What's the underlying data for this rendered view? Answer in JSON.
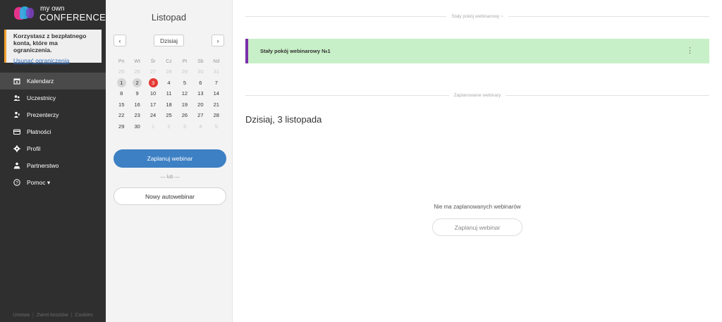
{
  "brand": {
    "line1": "my own",
    "line2": "CONFERENCE"
  },
  "notice": {
    "text": "Korzystasz z bezpłatnego konta, które ma ograniczenia.",
    "link": "Usunąć ograniczenia"
  },
  "nav": [
    {
      "label": "Kalendarz",
      "icon": "calendar-icon",
      "active": true
    },
    {
      "label": "Uczestnicy",
      "icon": "users-icon",
      "active": false
    },
    {
      "label": "Prezenterzy",
      "icon": "presenter-icon",
      "active": false
    },
    {
      "label": "Płatności",
      "icon": "card-icon",
      "active": false
    },
    {
      "label": "Profil",
      "icon": "gear-icon",
      "active": false
    },
    {
      "label": "Partnerstwo",
      "icon": "partnership-icon",
      "active": false
    },
    {
      "label": "Pomoc ▾",
      "icon": "help-icon",
      "active": false
    }
  ],
  "footer": [
    "Umowa",
    "Zwrot kosztów",
    "Cookies"
  ],
  "calendar": {
    "month": "Listopad",
    "prev": "‹",
    "next": "›",
    "today_label": "Dzisiaj",
    "weekdays": [
      "Pn",
      "Wt",
      "Śr",
      "Cz",
      "Pt",
      "Sb",
      "Nd"
    ],
    "weeks": [
      [
        {
          "d": "25",
          "s": "muted"
        },
        {
          "d": "26",
          "s": "muted"
        },
        {
          "d": "27",
          "s": "muted"
        },
        {
          "d": "28",
          "s": "muted"
        },
        {
          "d": "29",
          "s": "muted"
        },
        {
          "d": "30",
          "s": "muted"
        },
        {
          "d": "31",
          "s": "muted"
        }
      ],
      [
        {
          "d": "1",
          "s": "past"
        },
        {
          "d": "2",
          "s": "past"
        },
        {
          "d": "3",
          "s": "today"
        },
        {
          "d": "4",
          "s": ""
        },
        {
          "d": "5",
          "s": ""
        },
        {
          "d": "6",
          "s": ""
        },
        {
          "d": "7",
          "s": ""
        }
      ],
      [
        {
          "d": "8",
          "s": ""
        },
        {
          "d": "9",
          "s": ""
        },
        {
          "d": "10",
          "s": ""
        },
        {
          "d": "11",
          "s": ""
        },
        {
          "d": "12",
          "s": ""
        },
        {
          "d": "13",
          "s": ""
        },
        {
          "d": "14",
          "s": ""
        }
      ],
      [
        {
          "d": "15",
          "s": ""
        },
        {
          "d": "16",
          "s": ""
        },
        {
          "d": "17",
          "s": ""
        },
        {
          "d": "18",
          "s": ""
        },
        {
          "d": "19",
          "s": ""
        },
        {
          "d": "20",
          "s": ""
        },
        {
          "d": "21",
          "s": ""
        }
      ],
      [
        {
          "d": "22",
          "s": ""
        },
        {
          "d": "23",
          "s": ""
        },
        {
          "d": "24",
          "s": ""
        },
        {
          "d": "25",
          "s": ""
        },
        {
          "d": "26",
          "s": ""
        },
        {
          "d": "27",
          "s": ""
        },
        {
          "d": "28",
          "s": ""
        }
      ],
      [
        {
          "d": "29",
          "s": ""
        },
        {
          "d": "30",
          "s": ""
        },
        {
          "d": "1",
          "s": "muted"
        },
        {
          "d": "2",
          "s": "muted"
        },
        {
          "d": "3",
          "s": "muted"
        },
        {
          "d": "4",
          "s": "muted"
        },
        {
          "d": "5",
          "s": "muted"
        }
      ]
    ],
    "schedule_label": "Zaplanuj webinar",
    "or_label": "— lub —",
    "autowebinar_label": "Nowy autowebinar"
  },
  "main": {
    "permanent_section": "Stały pokój webinarowy ~",
    "room_name": "Stały pokój webinarowy №1",
    "room_menu": "⋮",
    "planned_section": "Zaplanowane webinary",
    "day_title": "Dzisiaj, 3 listopada",
    "empty_text": "Nie ma zaplanowanych webinarów",
    "empty_button": "Zaplanuj webinar"
  },
  "colors": {
    "sidebar": "#2f2f2f",
    "accent": "#3d80c4",
    "today": "#e53935",
    "room_bg": "#c8f0c8",
    "room_border": "#7b2fa8",
    "notice_border": "#f0a030"
  }
}
